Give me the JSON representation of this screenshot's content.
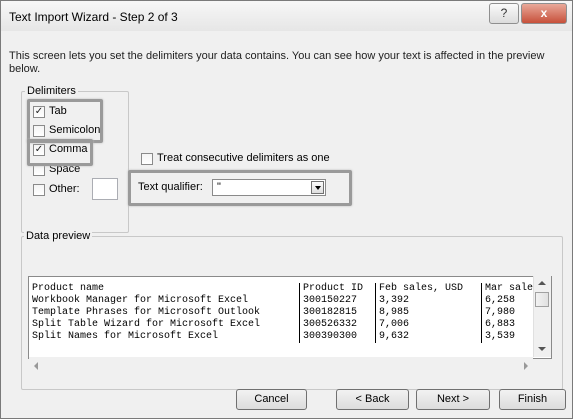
{
  "window": {
    "title": "Text Import Wizard - Step 2 of 3",
    "help_label": "?",
    "close_label": "x"
  },
  "intro": "This screen lets you set the delimiters your data contains.  You can see how your text is affected in the preview below.",
  "delimiters": {
    "label": "Delimiters",
    "items": [
      {
        "label": "Tab",
        "checked": true
      },
      {
        "label": "Semicolon",
        "checked": false
      },
      {
        "label": "Comma",
        "checked": true
      },
      {
        "label": "Space",
        "checked": false
      },
      {
        "label": "Other:",
        "checked": false
      }
    ],
    "other_value": ""
  },
  "treat_consecutive": {
    "label": "Treat consecutive delimiters as one",
    "checked": false
  },
  "text_qualifier": {
    "label": "Text qualifier:",
    "value": "\""
  },
  "preview": {
    "label": "Data preview",
    "rows": [
      [
        "Product name",
        "Product ID",
        "Feb sales, USD",
        "Mar sales,"
      ],
      [
        "Workbook Manager for Microsoft Excel",
        "300150227",
        "3,392",
        "6,258"
      ],
      [
        "Template Phrases for Microsoft Outlook",
        "300182815",
        "8,985",
        "7,980"
      ],
      [
        "Split Table Wizard for Microsoft Excel",
        "300526332",
        "7,006",
        "6,883"
      ],
      [
        "Split Names for Microsoft Excel",
        "300390300",
        "9,632",
        "3,539"
      ]
    ]
  },
  "buttons": {
    "cancel": "Cancel",
    "back": "< Back",
    "next": "Next >",
    "finish": "Finish"
  },
  "colors": {
    "highlight": "#9a9a9a",
    "close_button": "#c7503a"
  }
}
